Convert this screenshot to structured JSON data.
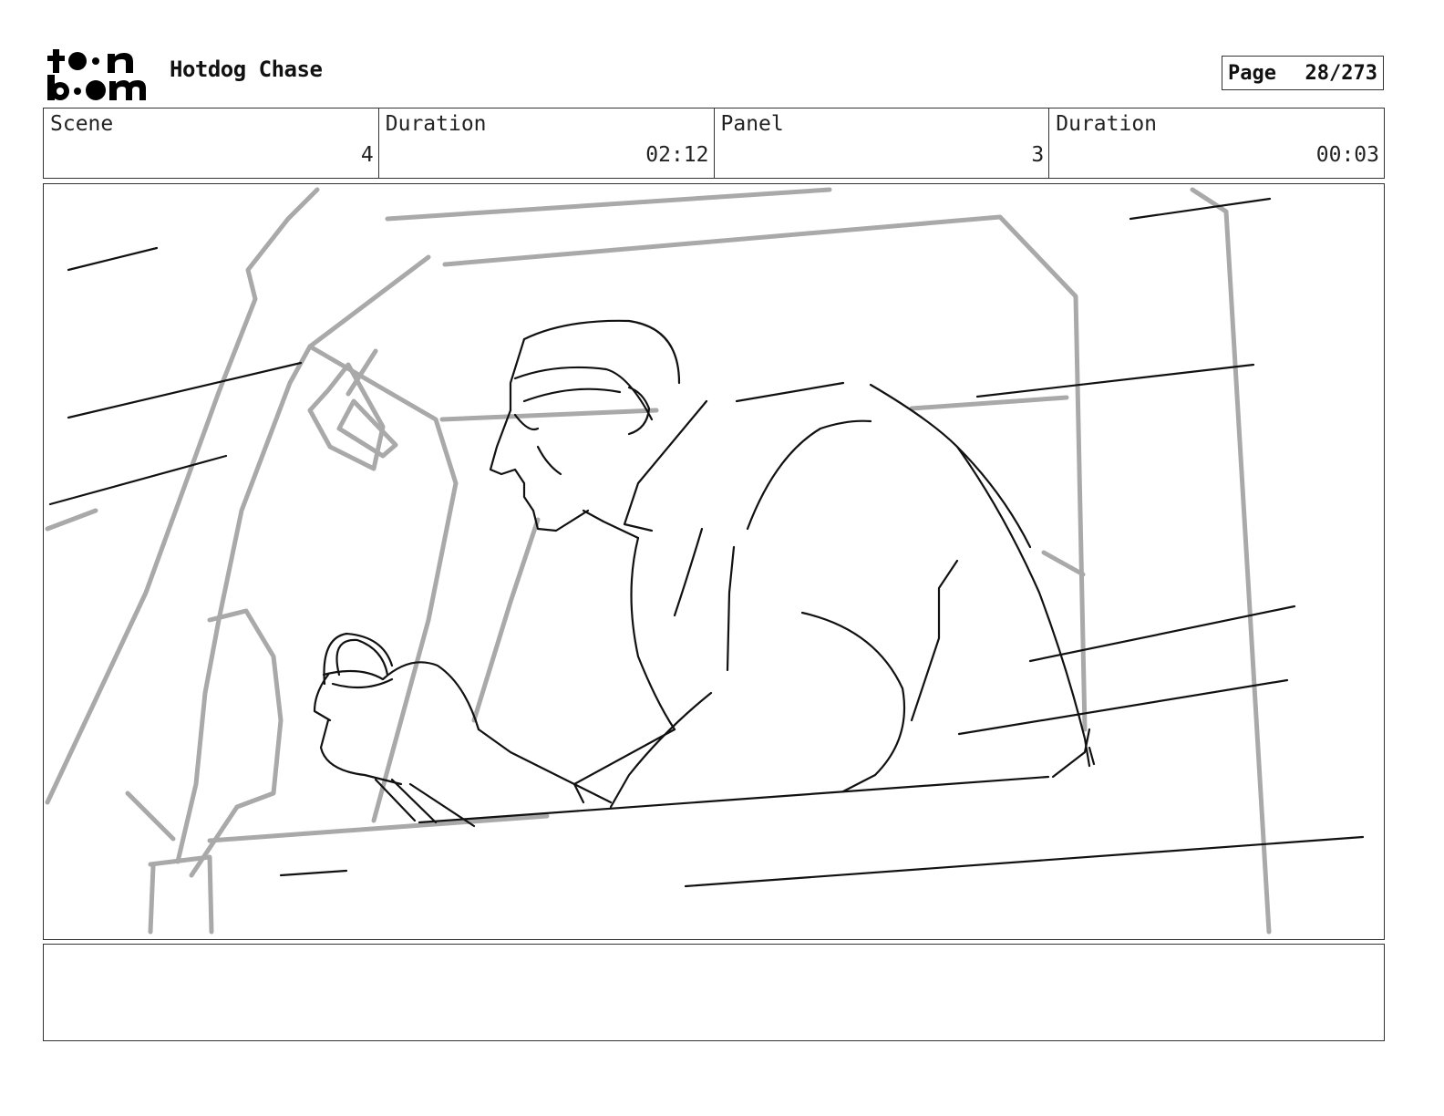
{
  "header": {
    "logo_text": "toon boom",
    "project_title": "Hotdog Chase",
    "page_label": "Page",
    "page_number": "28/273"
  },
  "info": {
    "scene_label": "Scene",
    "scene_value": "4",
    "scene_duration_label": "Duration",
    "scene_duration_value": "02:12",
    "panel_label": "Panel",
    "panel_value": "3",
    "panel_duration_label": "Duration",
    "panel_duration_value": "00:03"
  },
  "notes": {
    "text": ""
  }
}
